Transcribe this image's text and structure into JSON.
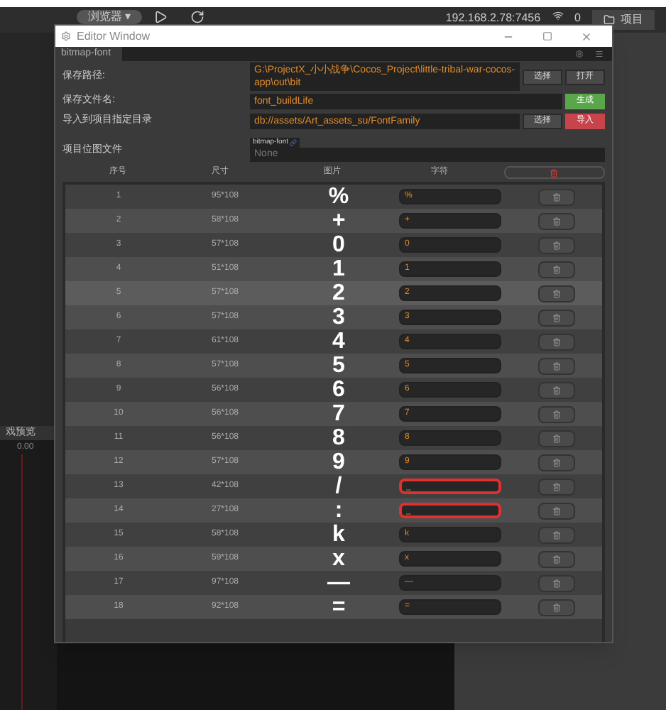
{
  "toolbar": {
    "browser_menu": "浏览器 ▾",
    "address": "192.168.2.78:7456",
    "count": "0",
    "project_button": "项目"
  },
  "background": {
    "panel_title": "戏预览",
    "time": "0.00"
  },
  "window": {
    "title": "Editor Window",
    "tab": "bitmap-font"
  },
  "form": [
    {
      "kind": "path",
      "label": "保存路径:",
      "value": "G:\\ProjectX_小小战争\\Cocos_Project\\little-tribal-war-cocos-app\\out\\bit",
      "buttons": [
        {
          "label": "选择",
          "kind": "plain"
        },
        {
          "label": "打开",
          "kind": "plain"
        }
      ]
    },
    {
      "kind": "path",
      "label": "保存文件名:",
      "value": "font_buildLife",
      "buttons": [
        {
          "label": "生成",
          "kind": "green"
        }
      ]
    },
    {
      "kind": "path",
      "label": "导入到项目指定目录",
      "value": "db://assets/Art_assets_su/FontFamily",
      "buttons": [
        {
          "label": "选择",
          "kind": "plain"
        },
        {
          "label": "导入",
          "kind": "red"
        }
      ]
    },
    {
      "kind": "asset",
      "label": "项目位图文件",
      "badge": "bitmap-font",
      "value": "None"
    }
  ],
  "table": {
    "columns": [
      "序号",
      "尺寸",
      "图片",
      "字符"
    ],
    "rows": [
      {
        "index": "1",
        "size": "95*108",
        "glyph": "%",
        "char": "%",
        "invalid": false
      },
      {
        "index": "2",
        "size": "58*108",
        "glyph": "+",
        "char": "+",
        "invalid": false
      },
      {
        "index": "3",
        "size": "57*108",
        "glyph": "0",
        "char": "0",
        "invalid": false
      },
      {
        "index": "4",
        "size": "51*108",
        "glyph": "1",
        "char": "1",
        "invalid": false
      },
      {
        "index": "5",
        "size": "57*108",
        "glyph": "2",
        "char": "2",
        "invalid": false
      },
      {
        "index": "6",
        "size": "57*108",
        "glyph": "3",
        "char": "3",
        "invalid": false
      },
      {
        "index": "7",
        "size": "61*108",
        "glyph": "4",
        "char": "4",
        "invalid": false
      },
      {
        "index": "8",
        "size": "57*108",
        "glyph": "5",
        "char": "5",
        "invalid": false
      },
      {
        "index": "9",
        "size": "56*108",
        "glyph": "6",
        "char": "6",
        "invalid": false
      },
      {
        "index": "10",
        "size": "56*108",
        "glyph": "7",
        "char": "7",
        "invalid": false
      },
      {
        "index": "11",
        "size": "56*108",
        "glyph": "8",
        "char": "8",
        "invalid": false
      },
      {
        "index": "12",
        "size": "57*108",
        "glyph": "9",
        "char": "9",
        "invalid": false
      },
      {
        "index": "13",
        "size": "42*108",
        "glyph": "/",
        "char": "_",
        "invalid": true
      },
      {
        "index": "14",
        "size": "27*108",
        "glyph": ":",
        "char": "_",
        "invalid": true
      },
      {
        "index": "15",
        "size": "58*108",
        "glyph": "k",
        "char": "k",
        "invalid": false
      },
      {
        "index": "16",
        "size": "59*108",
        "glyph": "x",
        "char": "x",
        "invalid": false
      },
      {
        "index": "17",
        "size": "97*108",
        "glyph": "—",
        "char": "—",
        "invalid": false
      },
      {
        "index": "18",
        "size": "92*108",
        "glyph": "=",
        "char": "=",
        "invalid": false
      }
    ]
  }
}
